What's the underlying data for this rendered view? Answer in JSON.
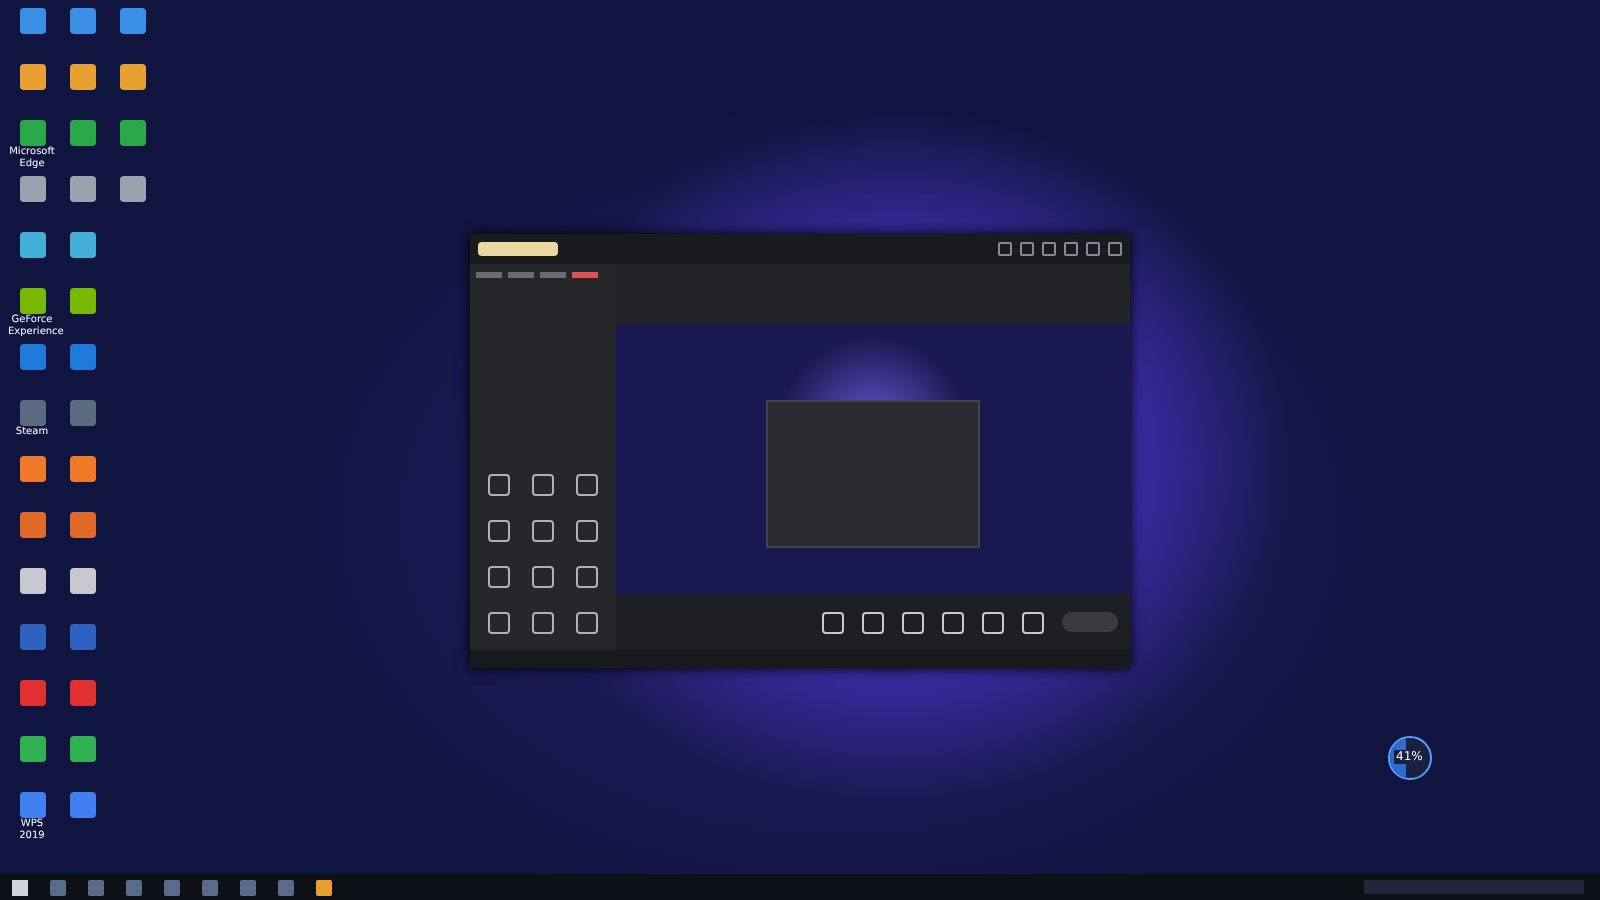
{
  "desktop_icons": [
    {
      "kind": "app"
    },
    {
      "kind": "app"
    },
    {
      "kind": "app",
      "label": "Microsoft Edge"
    },
    {
      "kind": "app"
    },
    {
      "kind": "app"
    },
    {
      "kind": "app",
      "label": "GeForce Experience"
    },
    {
      "kind": "app"
    },
    {
      "kind": "app",
      "label": "Steam"
    },
    {
      "kind": "app"
    },
    {
      "kind": "app"
    },
    {
      "kind": "app"
    },
    {
      "kind": "app"
    },
    {
      "kind": "app"
    },
    {
      "kind": "app"
    },
    {
      "kind": "app",
      "label": "WPS 2019"
    },
    {
      "kind": "app"
    },
    {
      "kind": "app"
    },
    {
      "kind": "app"
    },
    {
      "kind": "app"
    },
    {
      "kind": "app"
    },
    {
      "kind": "app"
    },
    {
      "kind": "app"
    },
    {
      "kind": "app"
    },
    {
      "kind": "app"
    },
    {
      "kind": "app"
    },
    {
      "kind": "app"
    },
    {
      "kind": "app"
    },
    {
      "kind": "app"
    },
    {
      "kind": "app"
    },
    {
      "kind": "app"
    },
    {
      "kind": "app"
    },
    {
      "kind": "app"
    },
    {
      "kind": "app"
    },
    {
      "kind": "app"
    }
  ],
  "gauge": {
    "reading": "41%",
    "level": 0.41
  },
  "sidebar_tabs": [
    {
      "selected": false
    },
    {
      "selected": false
    },
    {
      "selected": false
    },
    {
      "selected": true
    }
  ],
  "taskbar_icons": [
    {
      "selected": false
    },
    {
      "selected": false
    },
    {
      "selected": false
    },
    {
      "selected": false
    },
    {
      "selected": false
    },
    {
      "selected": false
    },
    {
      "selected": false
    },
    {
      "selected": true
    }
  ]
}
